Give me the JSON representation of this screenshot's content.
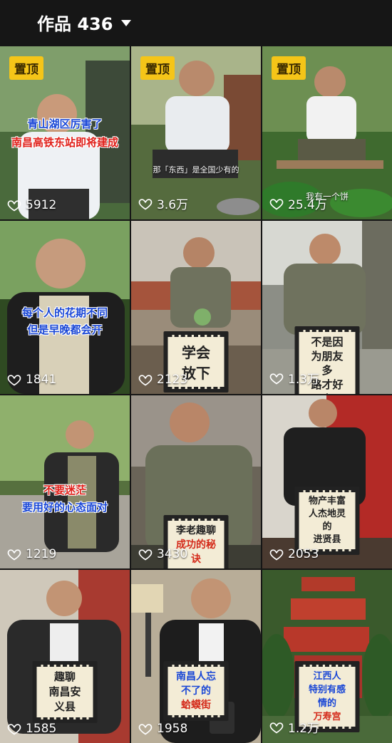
{
  "header": {
    "title": "作品 436"
  },
  "tiles": [
    {
      "pinned": "置顶",
      "caption": [
        "青山湖区厉害了",
        "南昌高铁东站即将建成"
      ],
      "views": "5912"
    },
    {
      "pinned": "置顶",
      "caption": [
        "那「东西」是全国少有的"
      ],
      "views": "3.6万"
    },
    {
      "pinned": "置顶",
      "caption": [
        "我有一个饼"
      ],
      "views": "25.4万"
    },
    {
      "caption": [
        "每个人的花期不同",
        "但是早晚都会开"
      ],
      "views": "1841"
    },
    {
      "caption": [
        "学会放下"
      ],
      "views": "2123"
    },
    {
      "caption": [
        "不是因为朋友多",
        "路才好走"
      ],
      "views": "1.3万"
    },
    {
      "caption": [
        "不要迷茫",
        "要用好的心态面对"
      ],
      "views": "1219"
    },
    {
      "caption": [
        "李老趣聊",
        "成功的秘诀"
      ],
      "views": "3430"
    },
    {
      "caption": [
        "物产丰富",
        "人杰地灵的",
        "进贤县"
      ],
      "views": "2053"
    },
    {
      "caption": [
        "趣聊",
        "南昌安义县"
      ],
      "views": "1585"
    },
    {
      "caption": [
        "南昌人忘不了的",
        "蛤蟆街"
      ],
      "views": "1958"
    },
    {
      "caption": [
        "江西人",
        "特别有感情的",
        "万寿宫"
      ],
      "views": "1.2万"
    }
  ]
}
